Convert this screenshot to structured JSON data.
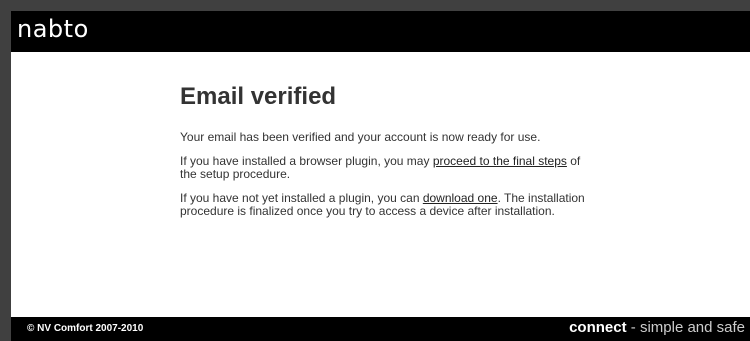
{
  "header": {
    "logo_text": "nabto"
  },
  "main": {
    "title": "Email verified",
    "paragraph1": "Your email has been verified and your account is now ready for use.",
    "paragraph2": {
      "before": "If you have installed a browser plugin, you may ",
      "link": "proceed to the final steps",
      "after": " of the setup procedure."
    },
    "paragraph3": {
      "before": "If you have not yet installed a plugin, you can ",
      "link": "download one",
      "after": ". The installation procedure is finalized once you try to access a device after installation."
    }
  },
  "footer": {
    "copyright": "© NV Comfort 2007-2010",
    "tagline_strong": "connect",
    "tagline_rest": " - simple and safe"
  },
  "colors": {
    "header_bg": "#000000",
    "page_bg": "#ffffff",
    "outer_bg": "#404040",
    "text": "#333333"
  }
}
